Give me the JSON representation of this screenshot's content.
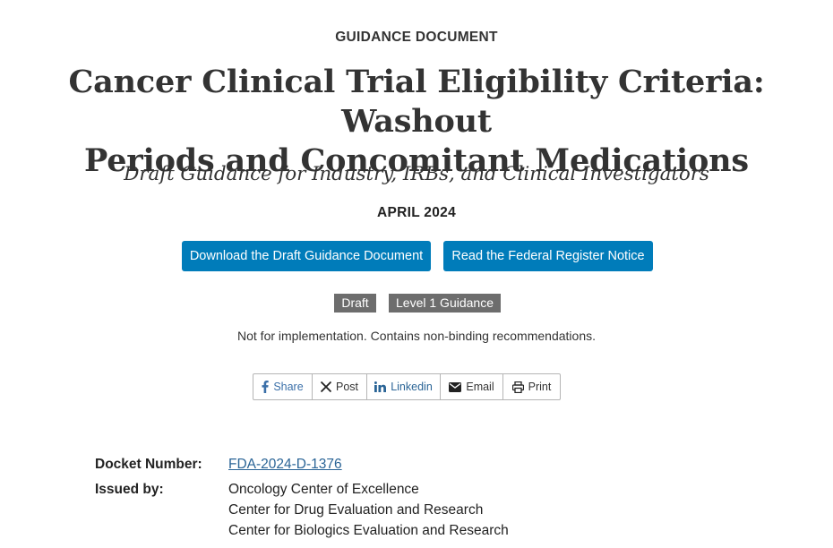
{
  "document_type": "GUIDANCE DOCUMENT",
  "title_line1": "Cancer Clinical Trial Eligibility Criteria: Washout",
  "title_line2": "Periods and Concomitant Medications",
  "subtitle": "Draft Guidance for Industry, IRBs, and Clinical Investigators",
  "date": "APRIL 2024",
  "buttons": {
    "download": "Download the Draft Guidance Document",
    "federal_register": "Read the Federal Register Notice",
    "color": "#007cba"
  },
  "badges": [
    "Draft",
    "Level 1 Guidance"
  ],
  "notice": "Not for implementation. Contains non-binding recommendations.",
  "share": {
    "share_label": "Share",
    "post_label": "Post",
    "linkedin_label": "Linkedin",
    "email_label": "Email",
    "print_label": "Print",
    "icons": [
      "facebook-icon",
      "x-icon",
      "linkedin-icon",
      "envelope-icon",
      "printer-icon"
    ]
  },
  "meta": {
    "docket_label": "Docket Number:",
    "docket_value": "FDA-2024-D-1376",
    "issued_label": "Issued by:",
    "issuers": [
      "Oncology Center of Excellence",
      "Center for Drug Evaluation and Research",
      "Center for Biologics Evaluation and Research"
    ]
  }
}
